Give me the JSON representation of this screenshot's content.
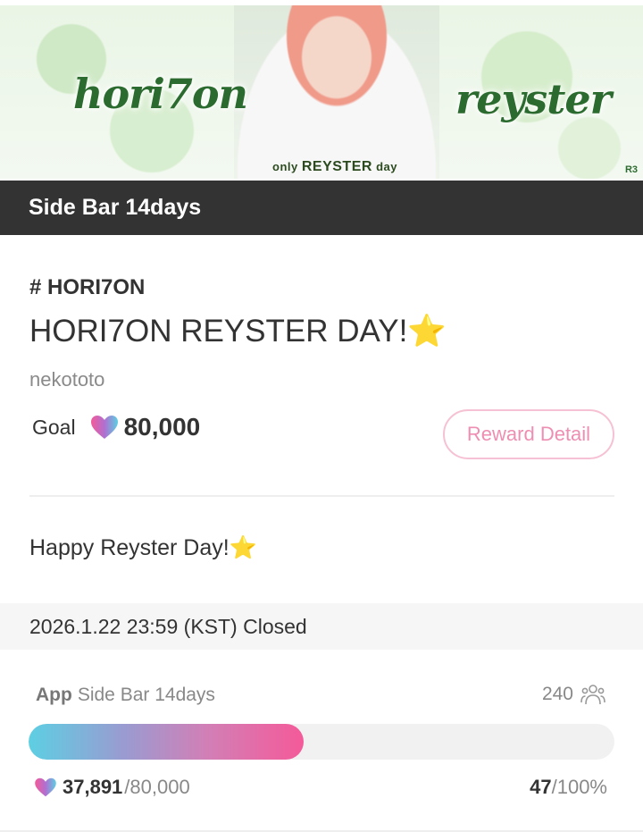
{
  "banner": {
    "left_text": "hori7on",
    "right_text": "reyster",
    "caption_small": "only",
    "caption_big": "REYSTER",
    "caption_day": "day",
    "mark": "R3"
  },
  "header": {
    "title": "Side Bar 14days"
  },
  "event": {
    "tag": "# HORI7ON",
    "title": "HORI7ON REYSTER DAY!",
    "title_emoji": "⭐",
    "author": "nekototo",
    "goal_label": "Goal",
    "goal_value": "80,000",
    "reward_button": "Reward Detail",
    "message": "Happy Reyster Day!",
    "message_emoji": "⭐"
  },
  "status": {
    "closed_text": "2026.1.22 23:59 (KST) Closed"
  },
  "progress": {
    "app_label": "App",
    "item_label": "Side Bar 14days",
    "participants": "240",
    "current": "37,891",
    "total": "/80,000",
    "percent": "47",
    "percent_total": "/100%",
    "fill_fraction": 0.47
  },
  "colors": {
    "header_bg": "#333333",
    "accent_pink": "#f45a99",
    "accent_cyan": "#5dcfe3",
    "button_border": "#f6c1d4"
  },
  "icons": {
    "heart": "heart-gradient-icon",
    "people": "people-icon"
  }
}
